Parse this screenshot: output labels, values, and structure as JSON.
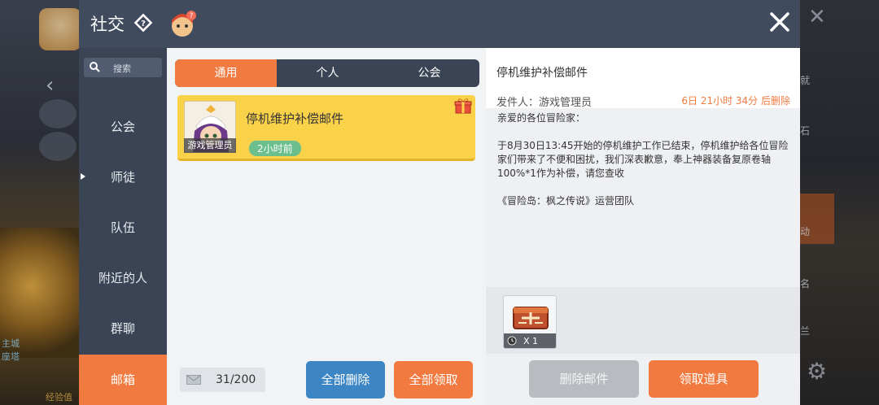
{
  "window": {
    "title": "社交"
  },
  "sidebar": {
    "search_label": "搜索",
    "items": [
      {
        "label": "公会"
      },
      {
        "label": "师徒"
      },
      {
        "label": "队伍"
      },
      {
        "label": "附近的人"
      },
      {
        "label": "群聊"
      },
      {
        "label": "邮箱"
      }
    ],
    "active_index": 5
  },
  "tabs": [
    {
      "label": "通用"
    },
    {
      "label": "个人"
    },
    {
      "label": "公会"
    }
  ],
  "mail_list": [
    {
      "subject": "停机维护补偿邮件",
      "sender_tag": "游戏管理员",
      "time": "2小时前"
    }
  ],
  "footer": {
    "mail_count": "31/200",
    "delete_all": "全部删除",
    "claim_all": "全部领取"
  },
  "detail": {
    "subject": "停机维护补偿邮件",
    "from_label": "发件人：游戏管理员",
    "expire": "6日 21小时 34分 后删除",
    "greeting": "亲爱的各位冒险家：",
    "paragraph": "于8月30日13:45开始的停机维护工作已结束，停机维护给各位冒险家们带来了不便和困扰，我们深表歉意，奉上神器装备复原卷轴100%*1作为补偿，请您查收",
    "signature": "《冒险岛：枫之传说》运营团队",
    "attachment_qty": "X 1",
    "delete_mail": "删除邮件",
    "claim_item": "领取道具"
  },
  "background": {
    "left_text_1": "主城",
    "left_text_2": "座塔",
    "left_text_3": "经验值+",
    "right_labels": [
      "就",
      "石",
      "动",
      "名",
      "兰"
    ]
  },
  "colors": {
    "accent": "#f07a3f",
    "header": "#414b5e",
    "sidebar": "#3b4455",
    "mail_card": "#fad24a",
    "button_blue": "#3c86c6"
  }
}
